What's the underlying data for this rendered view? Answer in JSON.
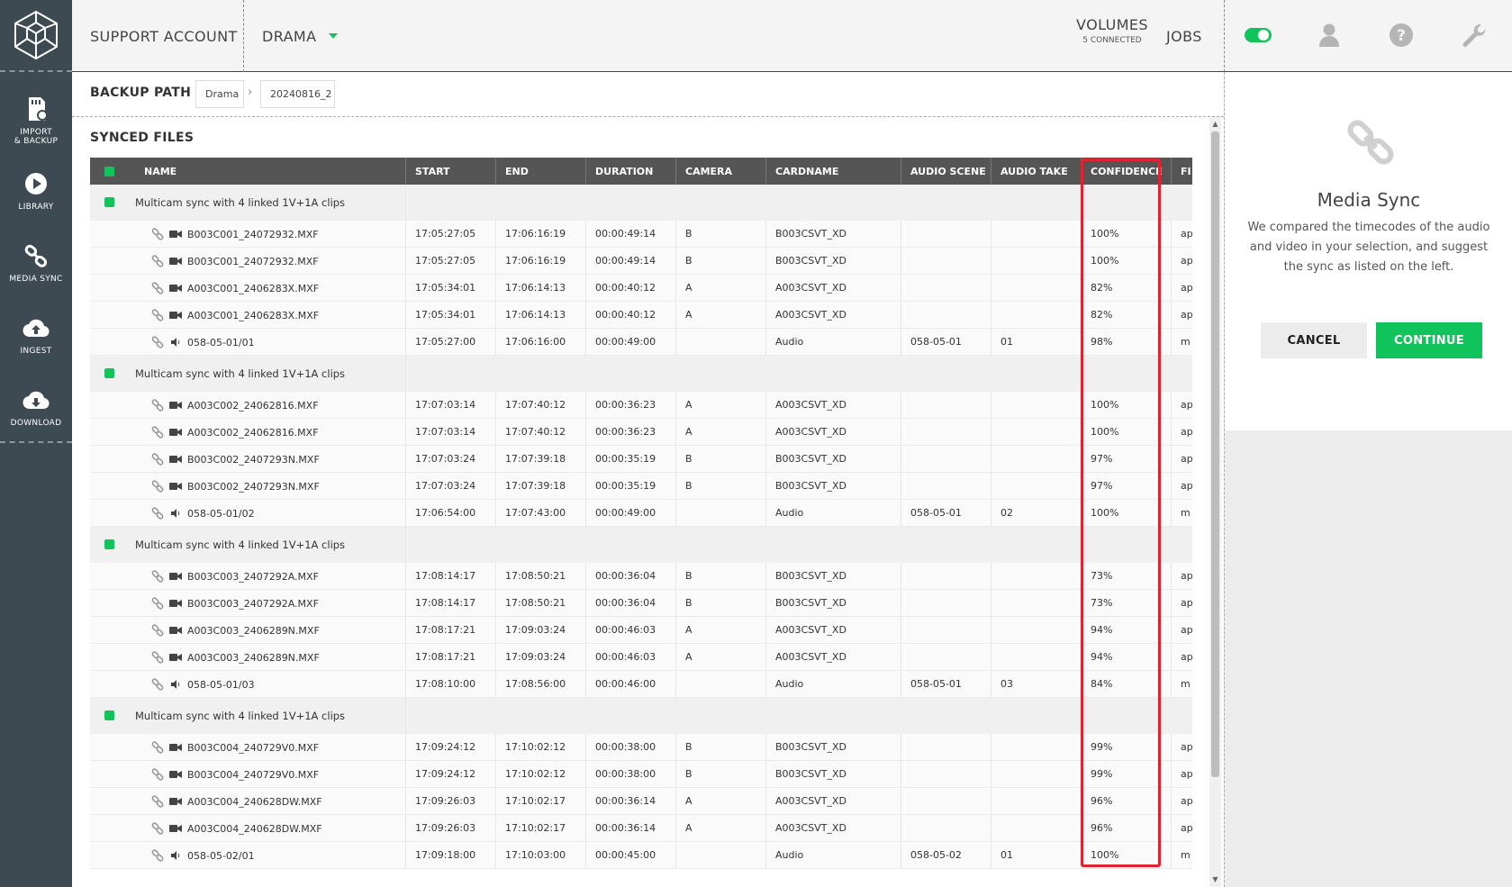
{
  "sidebar": {
    "logo": "cube-logo",
    "items": [
      {
        "label": "IMPORT\n& BACKUP",
        "icon": "sd-card-icon"
      },
      {
        "label": "LIBRARY",
        "icon": "play-circle-icon"
      },
      {
        "label": "MEDIA SYNC",
        "icon": "link-icon"
      },
      {
        "label": "INGEST",
        "icon": "cloud-upload-icon"
      },
      {
        "label": "DOWNLOAD",
        "icon": "cloud-download-icon"
      }
    ]
  },
  "header": {
    "account": "SUPPORT ACCOUNT",
    "project": "DRAMA",
    "volumes_label": "VOLUMES",
    "volumes_sub": "5 CONNECTED",
    "jobs": "JOBS",
    "toggle_state": "on",
    "accent": "#10c45b"
  },
  "pathbar": {
    "label": "BACKUP PATH",
    "crumbs": [
      "Drama",
      "20240816_2"
    ]
  },
  "synced": {
    "title": "SYNCED FILES",
    "columns": [
      "NAME",
      "START",
      "END",
      "DURATION",
      "CAMERA",
      "CARDNAME",
      "AUDIO SCENE",
      "AUDIO TAKE",
      "CONFIDENCE",
      "FI"
    ],
    "groups": [
      {
        "label": "Multicam sync with 4 linked 1V+1A clips",
        "files": [
          {
            "type": "video",
            "name": "B003C001_24072932.MXF",
            "start": "17:05:27:05",
            "end": "17:06:16:19",
            "duration": "00:00:49:14",
            "camera": "B",
            "cardname": "B003CSVT_XD",
            "scene": "",
            "take": "",
            "confidence": "100%",
            "fi": "ap"
          },
          {
            "type": "video",
            "name": "B003C001_24072932.MXF",
            "start": "17:05:27:05",
            "end": "17:06:16:19",
            "duration": "00:00:49:14",
            "camera": "B",
            "cardname": "B003CSVT_XD",
            "scene": "",
            "take": "",
            "confidence": "100%",
            "fi": "ap"
          },
          {
            "type": "video",
            "name": "A003C001_2406283X.MXF",
            "start": "17:05:34:01",
            "end": "17:06:14:13",
            "duration": "00:00:40:12",
            "camera": "A",
            "cardname": "A003CSVT_XD",
            "scene": "",
            "take": "",
            "confidence": "82%",
            "fi": "ap"
          },
          {
            "type": "video",
            "name": "A003C001_2406283X.MXF",
            "start": "17:05:34:01",
            "end": "17:06:14:13",
            "duration": "00:00:40:12",
            "camera": "A",
            "cardname": "A003CSVT_XD",
            "scene": "",
            "take": "",
            "confidence": "82%",
            "fi": "ap"
          },
          {
            "type": "audio",
            "name": "058-05-01/01",
            "start": "17:05:27:00",
            "end": "17:06:16:00",
            "duration": "00:00:49:00",
            "camera": "",
            "cardname": "Audio",
            "scene": "058-05-01",
            "take": "01",
            "confidence": "98%",
            "fi": "m"
          }
        ]
      },
      {
        "label": "Multicam sync with 4 linked 1V+1A clips",
        "files": [
          {
            "type": "video",
            "name": "A003C002_24062816.MXF",
            "start": "17:07:03:14",
            "end": "17:07:40:12",
            "duration": "00:00:36:23",
            "camera": "A",
            "cardname": "A003CSVT_XD",
            "scene": "",
            "take": "",
            "confidence": "100%",
            "fi": "ap"
          },
          {
            "type": "video",
            "name": "A003C002_24062816.MXF",
            "start": "17:07:03:14",
            "end": "17:07:40:12",
            "duration": "00:00:36:23",
            "camera": "A",
            "cardname": "A003CSVT_XD",
            "scene": "",
            "take": "",
            "confidence": "100%",
            "fi": "ap"
          },
          {
            "type": "video",
            "name": "B003C002_2407293N.MXF",
            "start": "17:07:03:24",
            "end": "17:07:39:18",
            "duration": "00:00:35:19",
            "camera": "B",
            "cardname": "B003CSVT_XD",
            "scene": "",
            "take": "",
            "confidence": "97%",
            "fi": "ap"
          },
          {
            "type": "video",
            "name": "B003C002_2407293N.MXF",
            "start": "17:07:03:24",
            "end": "17:07:39:18",
            "duration": "00:00:35:19",
            "camera": "B",
            "cardname": "B003CSVT_XD",
            "scene": "",
            "take": "",
            "confidence": "97%",
            "fi": "ap"
          },
          {
            "type": "audio",
            "name": "058-05-01/02",
            "start": "17:06:54:00",
            "end": "17:07:43:00",
            "duration": "00:00:49:00",
            "camera": "",
            "cardname": "Audio",
            "scene": "058-05-01",
            "take": "02",
            "confidence": "100%",
            "fi": "m"
          }
        ]
      },
      {
        "label": "Multicam sync with 4 linked 1V+1A clips",
        "files": [
          {
            "type": "video",
            "name": "B003C003_2407292A.MXF",
            "start": "17:08:14:17",
            "end": "17:08:50:21",
            "duration": "00:00:36:04",
            "camera": "B",
            "cardname": "B003CSVT_XD",
            "scene": "",
            "take": "",
            "confidence": "73%",
            "fi": "ap"
          },
          {
            "type": "video",
            "name": "B003C003_2407292A.MXF",
            "start": "17:08:14:17",
            "end": "17:08:50:21",
            "duration": "00:00:36:04",
            "camera": "B",
            "cardname": "B003CSVT_XD",
            "scene": "",
            "take": "",
            "confidence": "73%",
            "fi": "ap"
          },
          {
            "type": "video",
            "name": "A003C003_2406289N.MXF",
            "start": "17:08:17:21",
            "end": "17:09:03:24",
            "duration": "00:00:46:03",
            "camera": "A",
            "cardname": "A003CSVT_XD",
            "scene": "",
            "take": "",
            "confidence": "94%",
            "fi": "ap"
          },
          {
            "type": "video",
            "name": "A003C003_2406289N.MXF",
            "start": "17:08:17:21",
            "end": "17:09:03:24",
            "duration": "00:00:46:03",
            "camera": "A",
            "cardname": "A003CSVT_XD",
            "scene": "",
            "take": "",
            "confidence": "94%",
            "fi": "ap"
          },
          {
            "type": "audio",
            "name": "058-05-01/03",
            "start": "17:08:10:00",
            "end": "17:08:56:00",
            "duration": "00:00:46:00",
            "camera": "",
            "cardname": "Audio",
            "scene": "058-05-01",
            "take": "03",
            "confidence": "84%",
            "fi": "m"
          }
        ]
      },
      {
        "label": "Multicam sync with 4 linked 1V+1A clips",
        "files": [
          {
            "type": "video",
            "name": "B003C004_240729V0.MXF",
            "start": "17:09:24:12",
            "end": "17:10:02:12",
            "duration": "00:00:38:00",
            "camera": "B",
            "cardname": "B003CSVT_XD",
            "scene": "",
            "take": "",
            "confidence": "99%",
            "fi": "ap"
          },
          {
            "type": "video",
            "name": "B003C004_240729V0.MXF",
            "start": "17:09:24:12",
            "end": "17:10:02:12",
            "duration": "00:00:38:00",
            "camera": "B",
            "cardname": "B003CSVT_XD",
            "scene": "",
            "take": "",
            "confidence": "99%",
            "fi": "ap"
          },
          {
            "type": "video",
            "name": "A003C004_240628DW.MXF",
            "start": "17:09:26:03",
            "end": "17:10:02:17",
            "duration": "00:00:36:14",
            "camera": "A",
            "cardname": "A003CSVT_XD",
            "scene": "",
            "take": "",
            "confidence": "96%",
            "fi": "ap"
          },
          {
            "type": "video",
            "name": "A003C004_240628DW.MXF",
            "start": "17:09:26:03",
            "end": "17:10:02:17",
            "duration": "00:00:36:14",
            "camera": "A",
            "cardname": "A003CSVT_XD",
            "scene": "",
            "take": "",
            "confidence": "96%",
            "fi": "ap"
          },
          {
            "type": "audio",
            "name": "058-05-02/01",
            "start": "17:09:18:00",
            "end": "17:10:03:00",
            "duration": "00:00:45:00",
            "camera": "",
            "cardname": "Audio",
            "scene": "058-05-02",
            "take": "01",
            "confidence": "100%",
            "fi": "m"
          }
        ]
      }
    ]
  },
  "panel": {
    "title": "Media Sync",
    "description": "We compared the timecodes of the audio and video in your selection, and suggest the sync as listed on the left.",
    "cancel_label": "CANCEL",
    "continue_label": "CONTINUE"
  }
}
